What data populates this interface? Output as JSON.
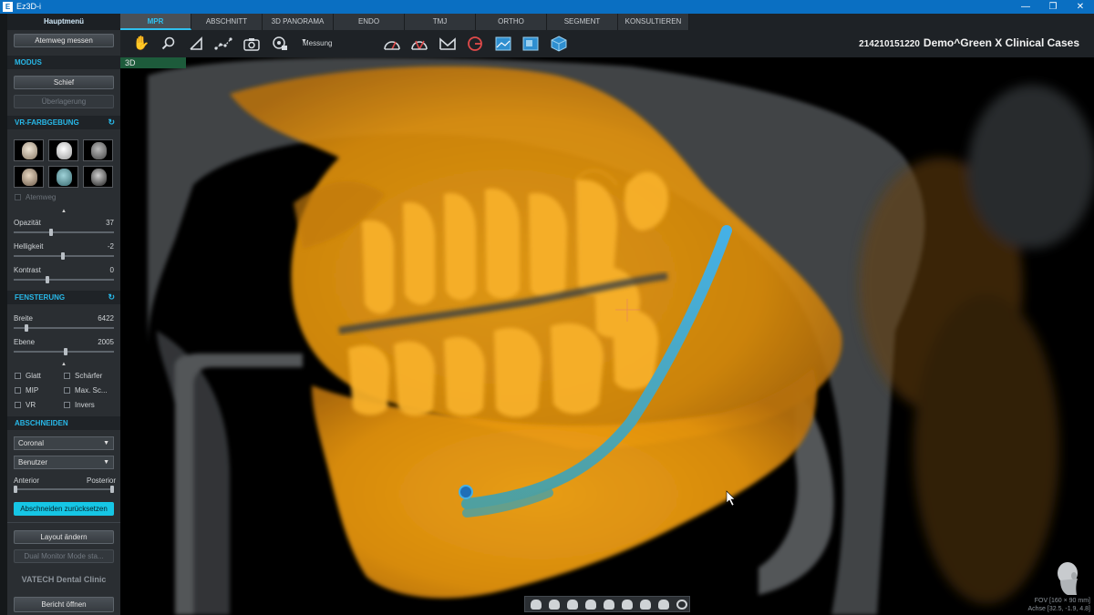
{
  "window": {
    "title": "Ez3D-i",
    "app_icon_letter": "E",
    "minimize": "—",
    "maximize": "❐",
    "close": "✕"
  },
  "left_panel": {
    "header": "Hauptmenü",
    "airway_button": "Atemweg messen",
    "modus": {
      "title": "MODUS",
      "schief_button": "Schief",
      "overlay_button": "Überlagerung"
    },
    "vr_color": {
      "title": "VR-FARBGEBUNG",
      "refresh_icon": "↻",
      "thumbnails": [
        "skull-preset-1",
        "skull-preset-2",
        "skull-preset-3",
        "skull-preset-4",
        "skull-preset-5",
        "skull-preset-6"
      ],
      "airway_checkbox": "Atemweg",
      "opacity_label": "Opazität",
      "opacity_value": "37",
      "opacity_fraction": 0.37,
      "brightness_label": "Helligkeit",
      "brightness_value": "-2",
      "brightness_fraction": 0.49,
      "contrast_label": "Kontrast",
      "contrast_value": "0",
      "contrast_fraction": 0.33
    },
    "windowing": {
      "title": "FENSTERUNG",
      "refresh_icon": "↻",
      "width_label": "Breite",
      "width_value": "6422",
      "width_fraction": 0.11,
      "level_label": "Ebene",
      "level_value": "2005",
      "level_fraction": 0.52,
      "checkboxes": [
        "Glatt",
        "Schärfer",
        "MIP",
        "Max. Sc...",
        "VR",
        "Invers"
      ]
    },
    "clipping": {
      "title": "ABSCHNEIDEN",
      "plane_select": "Coronal",
      "mode_select": "Benutzer",
      "anterior_label": "Anterior",
      "posterior_label": "Posterior",
      "reset_button": "Abschneiden zurücksetzen"
    },
    "layout_button": "Layout ändern",
    "dual_monitor_button": "Dual Monitor Mode sta...",
    "clinic_name": "VATECH Dental Clinic",
    "report_button": "Bericht öffnen"
  },
  "tabs": [
    "MPR",
    "ABSCHNITT",
    "3D PANORAMA",
    "ENDO",
    "TMJ",
    "ORTHO",
    "SEGMENT",
    "KONSULTIEREN"
  ],
  "active_tab": "MPR",
  "toolbar": {
    "tools": [
      "hand-icon",
      "zoom-icon",
      "angle-icon",
      "polyline-icon",
      "camera-icon",
      "video-icon"
    ],
    "measure_dropdown": "Messung",
    "view_tools": [
      "airway-icon-1",
      "airway-icon-2",
      "ruler-icon",
      "clip-icon",
      "image-icon-1",
      "image-icon-2",
      "cube-icon"
    ]
  },
  "patient": {
    "id": "214210151220",
    "name": "Demo^Green X Clinical Cases"
  },
  "viewport": {
    "label": "3D",
    "fov_line1": "FOV [160 × 90 mm]",
    "fov_line2": "Achse [32.5, -1.9, 4.8]",
    "colors": {
      "bone": "#f2a114",
      "canal": "#3aa8d8",
      "soft": "#9a9ea2"
    }
  }
}
